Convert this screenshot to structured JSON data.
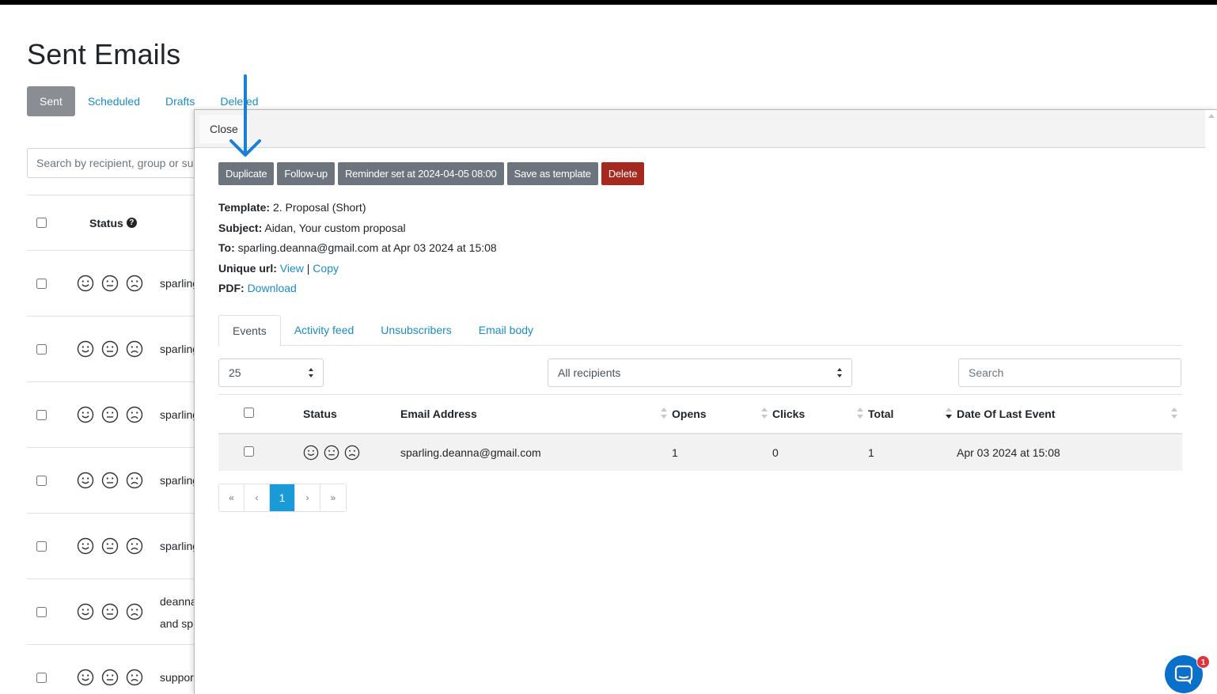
{
  "page": {
    "title": "Sent Emails",
    "tabs": [
      {
        "label": "Sent",
        "active": true
      },
      {
        "label": "Scheduled",
        "active": false
      },
      {
        "label": "Drafts",
        "active": false
      },
      {
        "label": "Deleted",
        "active": false
      }
    ],
    "search_placeholder": "Search by recipient, group or subject",
    "table": {
      "status_header": "Status",
      "rows": [
        {
          "recipient": "sparling.deanna@gmail.com"
        },
        {
          "recipient": "sparling.deanna@gmail.com"
        },
        {
          "recipient": "sparling.deanna@gmail.com"
        },
        {
          "recipient": "sparling.deanna@gmail.com"
        },
        {
          "recipient": "sparling.deanna@gmail.com"
        },
        {
          "recipient": "deanna",
          "recipient_line2": "and sp"
        },
        {
          "recipient": "support"
        }
      ]
    }
  },
  "panel": {
    "close_label": "Close",
    "actions": {
      "duplicate": "Duplicate",
      "follow_up": "Follow-up",
      "reminder": "Reminder set at 2024-04-05 08:00",
      "save_template": "Save as template",
      "delete": "Delete"
    },
    "meta": {
      "template_label": "Template:",
      "template_value": "2. Proposal (Short)",
      "subject_label": "Subject:",
      "subject_value": "Aidan, Your custom proposal",
      "to_label": "To:",
      "to_value": "sparling.deanna@gmail.com at Apr 03 2024 at 15:08",
      "unique_url_label": "Unique url:",
      "view_link": "View",
      "separator": "|",
      "copy_link": "Copy",
      "pdf_label": "PDF:",
      "download_link": "Download"
    },
    "tabs": [
      {
        "label": "Events",
        "active": true
      },
      {
        "label": "Activity feed",
        "active": false
      },
      {
        "label": "Unsubscribers",
        "active": false
      },
      {
        "label": "Email body",
        "active": false
      }
    ],
    "filters": {
      "page_size": "25",
      "recipients": "All recipients",
      "search_placeholder": "Search"
    },
    "events_table": {
      "headers": {
        "status": "Status",
        "email": "Email Address",
        "opens": "Opens",
        "clicks": "Clicks",
        "total": "Total",
        "last_event": "Date Of Last Event"
      },
      "rows": [
        {
          "email": "sparling.deanna@gmail.com",
          "opens": "1",
          "clicks": "0",
          "total": "1",
          "last_event": "Apr 03 2024 at 15:08"
        }
      ]
    },
    "pagination": {
      "first": "«",
      "prev": "‹",
      "current": "1",
      "next": "›",
      "last": "»"
    }
  },
  "chat": {
    "badge_count": "1",
    "icon": "chat-bubble-icon"
  },
  "colors": {
    "link": "#1a8cc4",
    "button_gray": "#6c757d",
    "button_danger": "#a5291e",
    "pagination_active": "#1a9ad6",
    "annotation_arrow": "#1a7fd6",
    "chat_launcher": "#0a70c9"
  }
}
